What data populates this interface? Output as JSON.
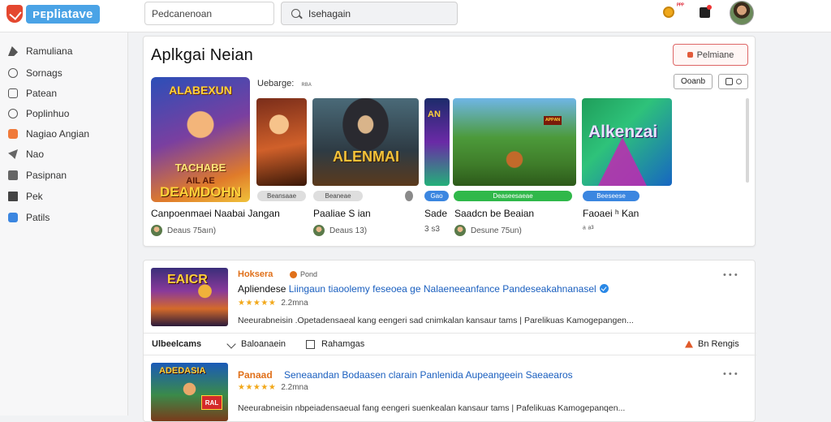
{
  "brand": {
    "logo_text": "ᴘᴇpliatave"
  },
  "search": {
    "left_placeholder": "Pedcanenoan",
    "main_placeholder": "Isehagain"
  },
  "header": {
    "notif_text": "ᴾᴾᴾ"
  },
  "sidebar": {
    "items": [
      {
        "label": "Ramuliana",
        "icon": "mountain-icon"
      },
      {
        "label": "Sornags",
        "icon": "circle-icon"
      },
      {
        "label": "Patean",
        "icon": "square-icon"
      },
      {
        "label": "Poplinhuo",
        "icon": "target-icon"
      },
      {
        "label": "Nagiao Angian",
        "icon": "app-icon"
      },
      {
        "label": "Nao",
        "icon": "bird-icon"
      },
      {
        "label": "Pasipnan",
        "icon": "grid-icon"
      },
      {
        "label": "Pek",
        "icon": "book-icon"
      },
      {
        "label": "Patils",
        "icon": "info-icon"
      }
    ]
  },
  "featured": {
    "title": "Aplkgai Neian",
    "primary_button": "Pelmiane",
    "subheading": "Uebarge:",
    "subheading_extra": "ʀʙᴀ",
    "small_button": "Ooanb",
    "hero": {
      "line1": "ALABEXUN",
      "line2": "TACHABE",
      "line3": "AIL AE",
      "line4": "DEAMDOHN"
    },
    "thumbs": {
      "t2": "ALENMAI",
      "t3": "AN",
      "t4": "ᴬᴾᴾᴬᴺ",
      "t5": "Alkenzai"
    },
    "pills": [
      "Beansaae",
      "Beaneae",
      "",
      "Gao",
      "Deaseesaeae",
      "Beeseese"
    ],
    "games": [
      {
        "name": "Canpoenmaei Naabai Jangan",
        "meta": "Deaus 75aın)"
      },
      {
        "name": "Paaliae S ian",
        "meta": "Deaus 13)"
      },
      {
        "name": "Sade",
        "meta": "3 s3"
      },
      {
        "name": "Saadcn be Beaian",
        "meta": "Desune 75un)"
      },
      {
        "name": "Faoaei ʰ Kan",
        "meta": "ᵃ ᵃ³"
      }
    ]
  },
  "list": {
    "items": [
      {
        "thumb_text": "EAICR",
        "title": "Hoksera",
        "badge": "Pond",
        "headline_a": "Apliendese",
        "headline_b": "Liingaun tiaoolemy feseoea ge Nalaeneeanfance Pandeseakahnanasel",
        "rating": "2.2mna",
        "desc": "Neeurabneisin .Opetadensaeal kang eengeri sad cnimkalan kansaur tams | Parelikuas Kamogepangen..."
      },
      {
        "thumb_text": "ADEDASIA",
        "thumb_badge": "RAL",
        "title": "Panaad",
        "headline_a": "Seneaandan Bodaasen clarain Panlenida Aupeangeein Saeaearos",
        "rating": "2.2mna",
        "desc": "Neeurabneisin nbpeiadensaeual fang eengeri suenkealan kansaur tams | Pafelikuas Kamogepanqen..."
      }
    ],
    "actions": {
      "left": "Ulbeelcams",
      "mid": "Baloanaein",
      "mid2": "Rahamgas",
      "right": "Bn Rengis"
    },
    "more": "• • •"
  }
}
